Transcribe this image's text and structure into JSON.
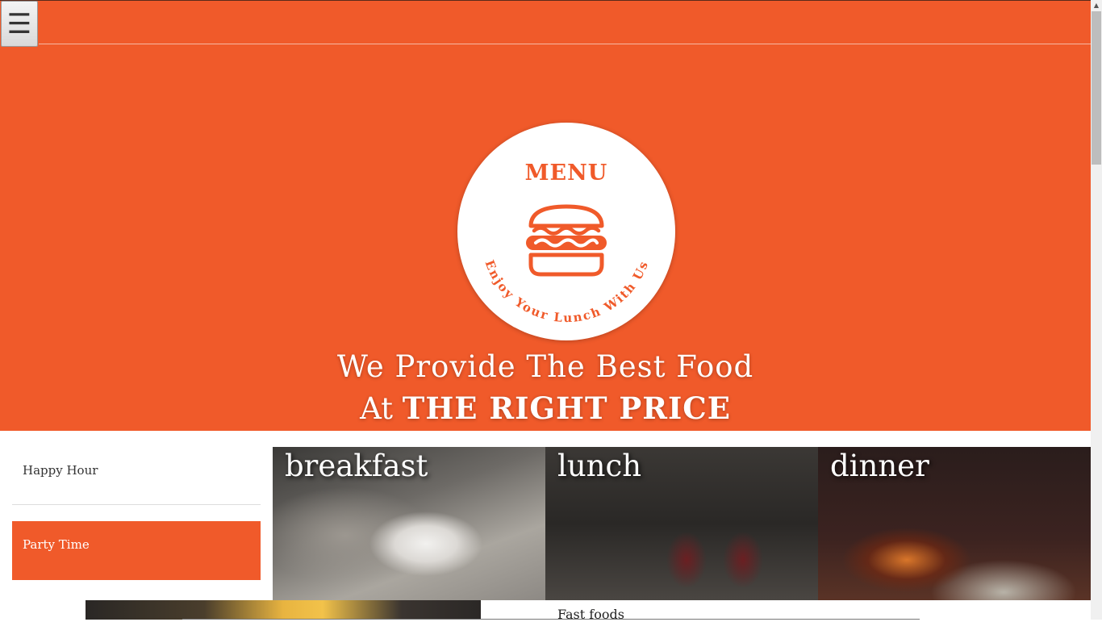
{
  "header": {
    "menu_icon": "hamburger-icon",
    "menu_glyph": "☰"
  },
  "hero": {
    "badge_title": "MENU",
    "badge_subtitle": "Enjoy Your Lunch With Us",
    "tagline_line1": "We Provide The Best Food",
    "tagline_line2_prefix": "At",
    "tagline_line2_emphasis": "THE RIGHT PRICE",
    "accent_color": "#f05a2a"
  },
  "tabs": [
    {
      "label": "Happy Hour",
      "active": false
    },
    {
      "label": "Party Time",
      "active": true
    }
  ],
  "cards": [
    {
      "label": "breakfast"
    },
    {
      "label": "lunch"
    },
    {
      "label": "dinner"
    }
  ],
  "section": {
    "title": "Fast foods"
  },
  "scrollbar": {
    "up_glyph": "▲"
  }
}
